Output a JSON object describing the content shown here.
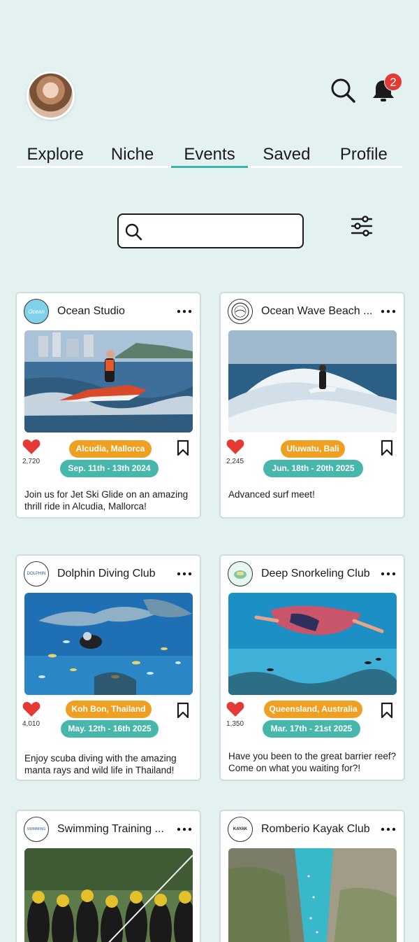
{
  "header": {
    "notification_count": "2"
  },
  "tabs": [
    {
      "label": "Explore"
    },
    {
      "label": "Niche"
    },
    {
      "label": "Events",
      "active": true
    },
    {
      "label": "Saved"
    },
    {
      "label": "Profile"
    }
  ],
  "search": {
    "value": "",
    "placeholder": ""
  },
  "colors": {
    "background": "#e3f1f0",
    "accent": "#3bb3ab",
    "location_pill": "#efa023",
    "date_pill": "#48b7ab",
    "heart": "#e53935",
    "badge": "#e53935"
  },
  "cards": [
    {
      "club": "Ocean Studio",
      "logo_text": "Ocean",
      "likes": "2,720",
      "location": "Alcudia, Mallorca",
      "dates": "Sep. 11th - 13th 2024",
      "description": "Join us for Jet Ski Glide on an amazing thrill ride in Alcudia, Mallorca!",
      "image": "jet-ski-photo"
    },
    {
      "club": "Ocean Wave Beach ...",
      "logo_text": "",
      "likes": "2,245",
      "location": "Uluwatu, Bali",
      "dates": "Jun. 18th - 20th 2025",
      "description": "Advanced surf meet!",
      "image": "surf-photo"
    },
    {
      "club": "Dolphin Diving Club",
      "logo_text": "DOLPHIN",
      "likes": "4,010",
      "location": "Koh Bon, Thailand",
      "dates": "May. 12th - 16th 2025",
      "description": "Enjoy scuba diving with the amazing manta rays and wild life in Thailand!",
      "image": "diving-photo"
    },
    {
      "club": "Deep Snorkeling Club",
      "logo_text": "",
      "likes": "1,350",
      "location": "Queensland, Australia",
      "dates": "Mar. 17th - 21st 2025",
      "description": "Have you been to the great barrier reef? Come on what you waiting for?!",
      "image": "snorkel-photo"
    },
    {
      "club": "Swimming Training ...",
      "logo_text": "SWIMMING",
      "image": "swimmers-photo"
    },
    {
      "club": "Romberio Kayak Club",
      "logo_text": "KAYAK",
      "image": "kayak-canyon-photo"
    }
  ]
}
